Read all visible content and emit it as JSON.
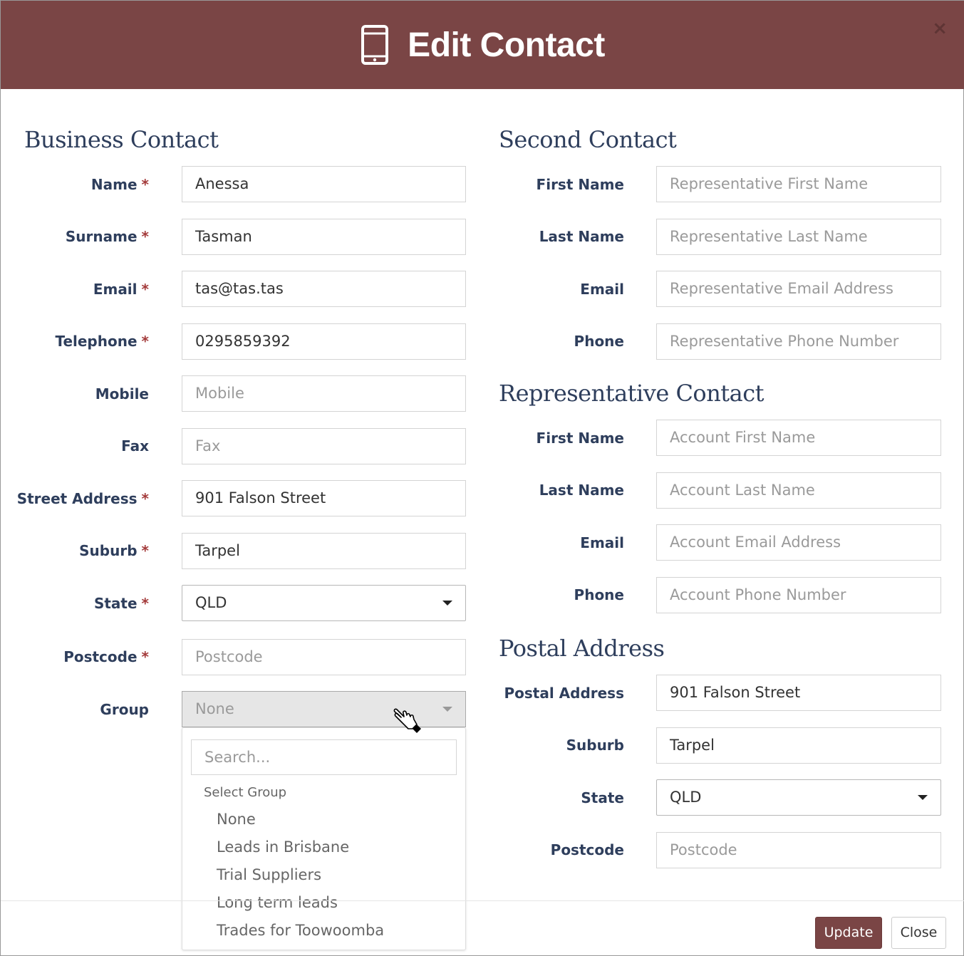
{
  "modal": {
    "title": "Edit Contact",
    "close_glyph": "×",
    "header_color": "#7a4545",
    "icon": "phone-icon"
  },
  "business_contact": {
    "title": "Business Contact",
    "fields": {
      "name": {
        "label": "Name",
        "required": "*",
        "value": "Anessa"
      },
      "surname": {
        "label": "Surname",
        "required": "*",
        "value": "Tasman"
      },
      "email": {
        "label": "Email",
        "required": "*",
        "value": "tas@tas.tas"
      },
      "telephone": {
        "label": "Telephone",
        "required": "*",
        "value": "0295859392"
      },
      "mobile": {
        "label": "Mobile",
        "placeholder": "Mobile"
      },
      "fax": {
        "label": "Fax",
        "placeholder": "Fax"
      },
      "street": {
        "label": "Street Address",
        "required": "*",
        "value": "901 Falson Street"
      },
      "suburb": {
        "label": "Suburb",
        "required": "*",
        "value": "Tarpel"
      },
      "state": {
        "label": "State",
        "required": "*",
        "value": "QLD"
      },
      "postcode": {
        "label": "Postcode",
        "required": "*",
        "placeholder": "Postcode"
      },
      "group": {
        "label": "Group",
        "value": "None"
      }
    }
  },
  "group_dropdown": {
    "search_placeholder": "Search...",
    "group_header": "Select Group",
    "options": [
      "None",
      "Leads in Brisbane",
      "Trial Suppliers",
      "Long term leads",
      "Trades for Toowoomba"
    ]
  },
  "second_contact": {
    "title": "Second Contact",
    "fields": {
      "first_name": {
        "label": "First Name",
        "placeholder": "Representative First Name"
      },
      "last_name": {
        "label": "Last Name",
        "placeholder": "Representative Last Name"
      },
      "email": {
        "label": "Email",
        "placeholder": "Representative Email Address"
      },
      "phone": {
        "label": "Phone",
        "placeholder": "Representative Phone Number"
      }
    }
  },
  "representative_contact": {
    "title": "Representative Contact",
    "fields": {
      "first_name": {
        "label": "First Name",
        "placeholder": "Account First Name"
      },
      "last_name": {
        "label": "Last Name",
        "placeholder": "Account Last Name"
      },
      "email": {
        "label": "Email",
        "placeholder": "Account Email Address"
      },
      "phone": {
        "label": "Phone",
        "placeholder": "Account Phone Number"
      }
    }
  },
  "postal_address": {
    "title": "Postal Address",
    "fields": {
      "address": {
        "label": "Postal Address",
        "value": "901 Falson Street"
      },
      "suburb": {
        "label": "Suburb",
        "value": "Tarpel"
      },
      "state": {
        "label": "State",
        "value": "QLD"
      },
      "postcode": {
        "label": "Postcode",
        "placeholder": "Postcode"
      }
    }
  },
  "footer": {
    "update_label": "Update",
    "close_label": "Close"
  }
}
